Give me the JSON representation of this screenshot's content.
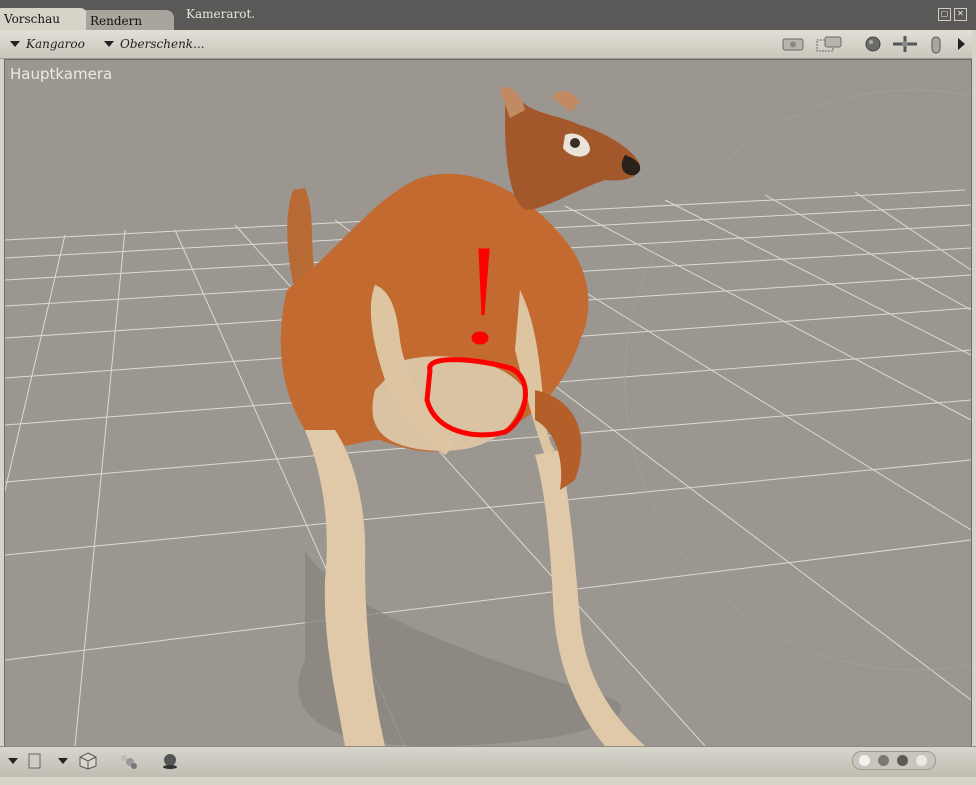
{
  "tabs": [
    {
      "label": "Vorschau",
      "active": true
    },
    {
      "label": "Rendern",
      "active": false
    }
  ],
  "window_title": "Kamerarot.",
  "toolbar": {
    "figure_dropdown": "Kangaroo",
    "part_dropdown": "Oberschenk...",
    "icons": [
      "camera-icon",
      "render-camera-icon",
      "trackball-icon",
      "move-cross-icon",
      "hand-icon",
      "expand-arrow-icon"
    ]
  },
  "viewport": {
    "camera_label": "Hauptkamera",
    "background": "#9c9690",
    "grid_color": "#d9d6d1",
    "annotation_color": "#ff0000"
  },
  "bottom_toolbar": {
    "icons": [
      "box-icon",
      "cube-icon",
      "spheres-icon",
      "light-ball-icon"
    ],
    "dots": [
      "#f2f2f0",
      "#7a7873",
      "#5c5a56",
      "#e9e8e4"
    ]
  }
}
